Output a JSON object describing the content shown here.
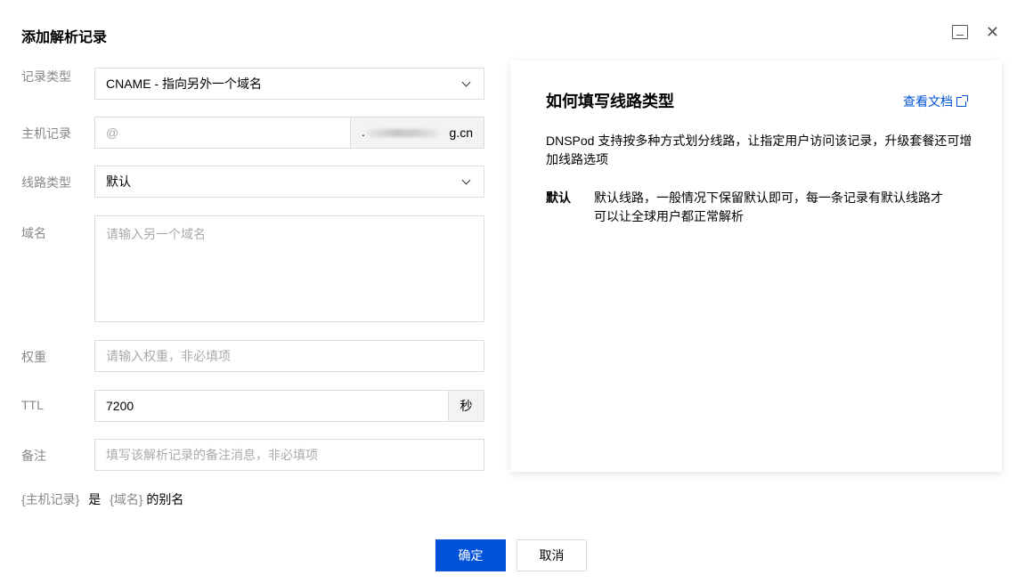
{
  "dialog": {
    "title": "添加解析记录"
  },
  "form": {
    "record_type": {
      "label": "记录类型",
      "value": "CNAME - 指向另外一个域名"
    },
    "host": {
      "label": "主机记录",
      "value": "@",
      "domain_suffix_visible": "g.cn",
      "domain_suffix_prefix": "."
    },
    "line_type": {
      "label": "线路类型",
      "value": "默认"
    },
    "domain": {
      "label": "域名",
      "placeholder": "请输入另一个域名"
    },
    "weight": {
      "label": "权重",
      "placeholder": "请输入权重，非必填项"
    },
    "ttl": {
      "label": "TTL",
      "value": "7200",
      "unit": "秒"
    },
    "remark": {
      "label": "备注",
      "placeholder": "填写该解析记录的备注消息，非必填项"
    }
  },
  "note": {
    "host_token": "{主机记录}",
    "is_text": "是",
    "domain_token": "{域名}",
    "suffix_text": "的别名"
  },
  "panel": {
    "title": "如何填写线路类型",
    "doc_link": "查看文档",
    "description": "DNSPod 支持按多种方式划分线路，让指定用户访问该记录，升级套餐还可增加线路选项",
    "term": "默认",
    "definition": "默认线路，一般情况下保留默认即可，每一条记录有默认线路才可以让全球用户都正常解析"
  },
  "buttons": {
    "ok": "确定",
    "cancel": "取消"
  },
  "colors": {
    "primary": "#0052d9",
    "label": "#888888",
    "border": "#dcdcdc"
  }
}
